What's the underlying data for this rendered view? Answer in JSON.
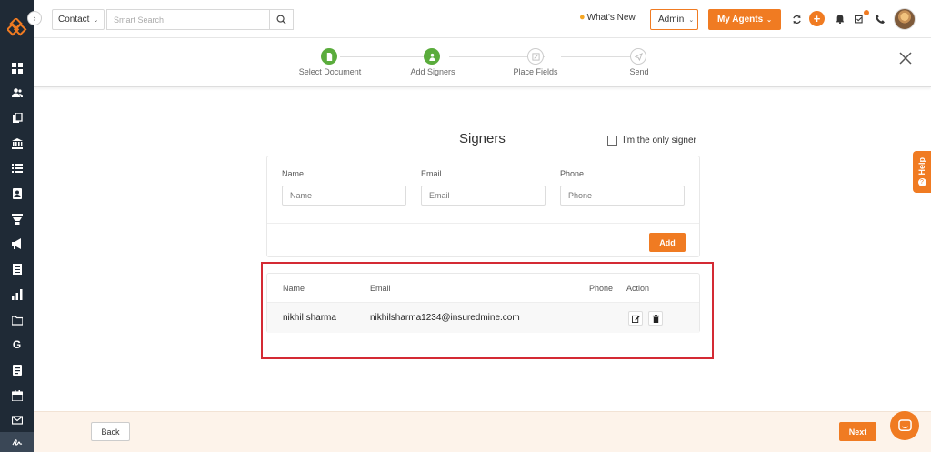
{
  "topbar": {
    "contact_label": "Contact",
    "search_placeholder": "Smart Search",
    "whats_new": "What's New",
    "admin_label": "Admin",
    "agents_label": "My Agents"
  },
  "sidebar": {
    "items": [
      "dashboard-icon",
      "users-icon",
      "documents-icon",
      "bank-icon",
      "list-icon",
      "contact-card-icon",
      "filter-icon",
      "megaphone-icon",
      "report-icon",
      "chart-icon",
      "folder-icon",
      "google-icon",
      "notes-icon",
      "calendar-icon",
      "mail-icon",
      "signature-icon"
    ]
  },
  "stepper": {
    "steps": [
      {
        "label": "Select Document",
        "status": "done"
      },
      {
        "label": "Add Signers",
        "status": "done"
      },
      {
        "label": "Place Fields",
        "status": "pending"
      },
      {
        "label": "Send",
        "status": "pending"
      }
    ]
  },
  "signers": {
    "title": "Signers",
    "only_signer_label": "I'm the only signer",
    "form": {
      "name_label": "Name",
      "name_placeholder": "Name",
      "email_label": "Email",
      "email_placeholder": "Email",
      "phone_label": "Phone",
      "phone_placeholder": "Phone",
      "add_label": "Add"
    },
    "table": {
      "headers": {
        "name": "Name",
        "email": "Email",
        "phone": "Phone",
        "action": "Action"
      },
      "rows": [
        {
          "name": "nikhil sharma",
          "email": "nikhilsharma1234@insuredmine.com",
          "phone": ""
        }
      ]
    }
  },
  "help_label": "Help",
  "footer": {
    "back_label": "Back",
    "next_label": "Next"
  },
  "colors": {
    "accent": "#f07b22",
    "sidebar_bg": "#1f2a36",
    "step_done": "#5aac3c",
    "highlight": "#d42a34"
  }
}
